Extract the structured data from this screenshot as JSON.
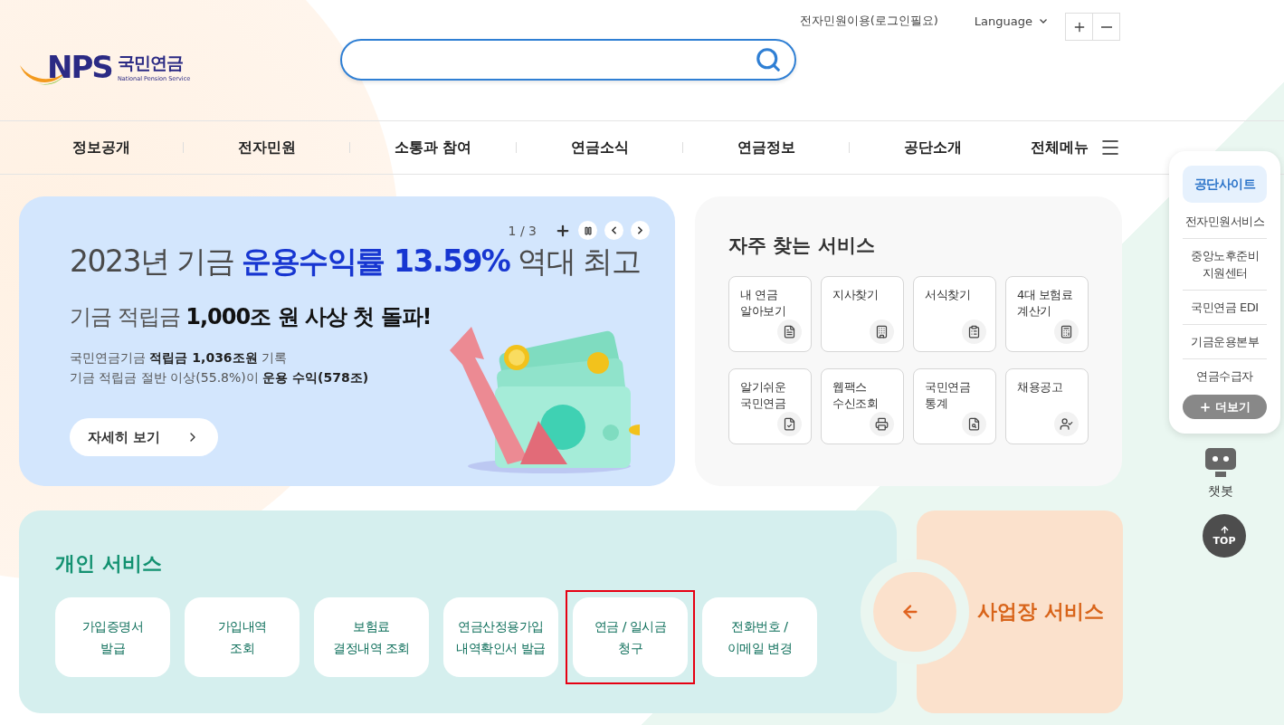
{
  "logo": {
    "mark": "NPS",
    "name": "국민연금",
    "subtitle": "National Pension Service"
  },
  "top_links": [
    {
      "kind": "link",
      "label": "전자민원이용(로그인필요)"
    },
    {
      "kind": "dropdown",
      "label": "Language"
    }
  ],
  "nav": {
    "items": [
      "정보공개",
      "전자민원",
      "소통과 참여",
      "연금소식",
      "연금정보",
      "공단소개"
    ],
    "all_menu": "전체메뉴"
  },
  "hero": {
    "counter": "1 / 3",
    "title": "2023년 기금 **운용수익률 13.59%** 역대 최고",
    "subtitle": "기금 적립금 **1,000조 원 사상 첫 돌파!**",
    "lines": [
      "국민연금기금 **적립금 1,036조원** 기록",
      "기금 적립금 절반 이상(55.8%)이 **운용 수익(578조)**"
    ],
    "button": "자세히 보기"
  },
  "frequent": {
    "title": "자주 찾는 서비스",
    "items": [
      "내 연금\n알아보기",
      "지사찾기",
      "서식찾기",
      "4대 보험료\n계산기",
      "알기쉬운\n국민연금",
      "웹팩스\n수신조회",
      "국민연금\n통계",
      "채용공고"
    ]
  },
  "personal": {
    "title": "개인 서비스",
    "items": [
      {
        "label": "가입증명서\n발급",
        "highlighted": false
      },
      {
        "label": "가입내역\n조회",
        "highlighted": false
      },
      {
        "label": "보험료\n결정내역 조회",
        "highlighted": false
      },
      {
        "label": "연금산정용가입\n내역확인서 발급",
        "highlighted": false
      },
      {
        "label": "연금 / 일시금\n청구",
        "highlighted": true
      },
      {
        "label": "전화번호 /\n이메일 변경",
        "highlighted": false
      }
    ]
  },
  "business": {
    "label": "사업장 서비스"
  },
  "side_panel": {
    "items": [
      {
        "label": "공단사이트",
        "selected": true
      },
      {
        "label": "전자민원서비스",
        "selected": false
      },
      {
        "label": "중앙노후준비\n지원센터",
        "selected": false
      },
      {
        "label": "국민연금 EDI",
        "selected": false
      },
      {
        "label": "기금운용본부",
        "selected": false
      },
      {
        "label": "연금수급자",
        "selected": false
      }
    ],
    "more": "더보기"
  },
  "chatbot": {
    "label": "챗봇"
  },
  "top_button": {
    "label": "TOP"
  }
}
